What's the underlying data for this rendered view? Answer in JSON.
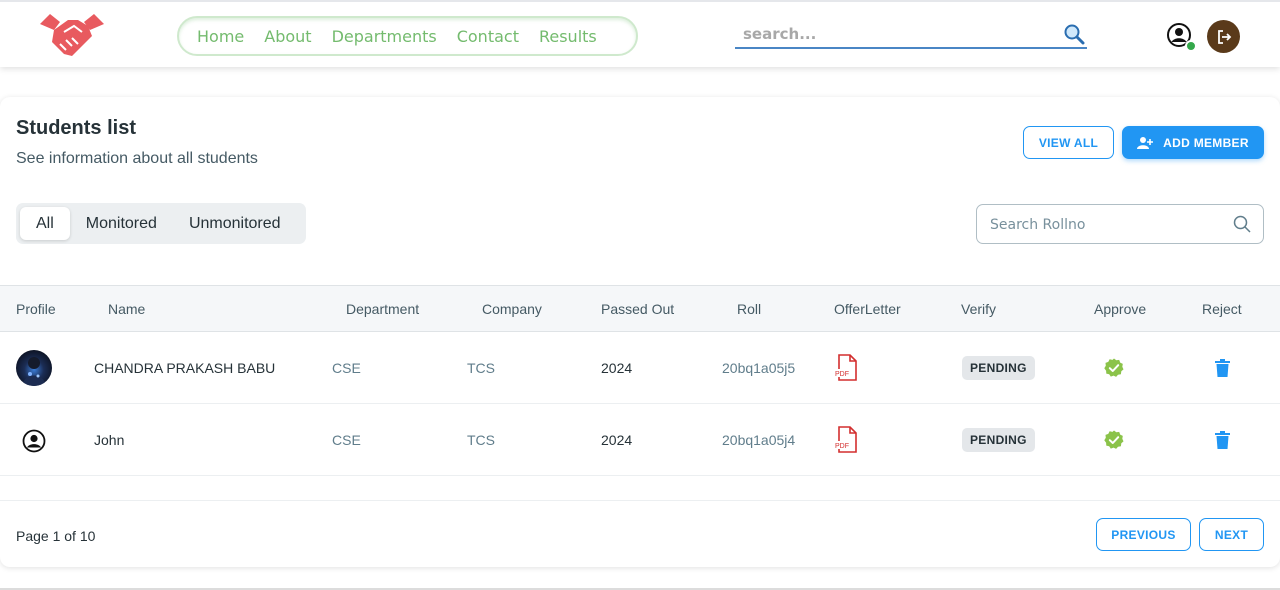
{
  "header": {
    "nav": [
      "Home",
      "About",
      "Departments",
      "Contact",
      "Results"
    ],
    "search_placeholder": "search..."
  },
  "page": {
    "title": "Students list",
    "subtitle": "See information about all students",
    "view_all": "VIEW ALL",
    "add_member": "ADD MEMBER",
    "tabs": [
      "All",
      "Monitored",
      "Unmonitored"
    ],
    "active_tab": "All",
    "search_placeholder": "Search Rollno"
  },
  "table": {
    "columns": [
      "Profile",
      "Name",
      "Department",
      "Company",
      "Passed Out",
      "Roll",
      "OfferLetter",
      "Verify",
      "Approve",
      "Reject"
    ],
    "rows": [
      {
        "name": "CHANDRA PRAKASH BABU",
        "department": "CSE",
        "company": "TCS",
        "passed_out": "2024",
        "roll": "20bq1a05j5",
        "verify": "PENDING",
        "pdf_label": "PDF"
      },
      {
        "name": "John",
        "department": "CSE",
        "company": "TCS",
        "passed_out": "2024",
        "roll": "20bq1a05j4",
        "verify": "PENDING",
        "pdf_label": "PDF"
      }
    ]
  },
  "footer": {
    "page_info": "Page 1 of 10",
    "previous": "PREVIOUS",
    "next": "NEXT"
  },
  "colors": {
    "accent": "#2196f3",
    "nav_green": "#74bb6e",
    "logo_red": "#e85a5f",
    "approve_green": "#8bc34a",
    "online": "#34a84b",
    "logout_bg": "#5a3a1a"
  }
}
